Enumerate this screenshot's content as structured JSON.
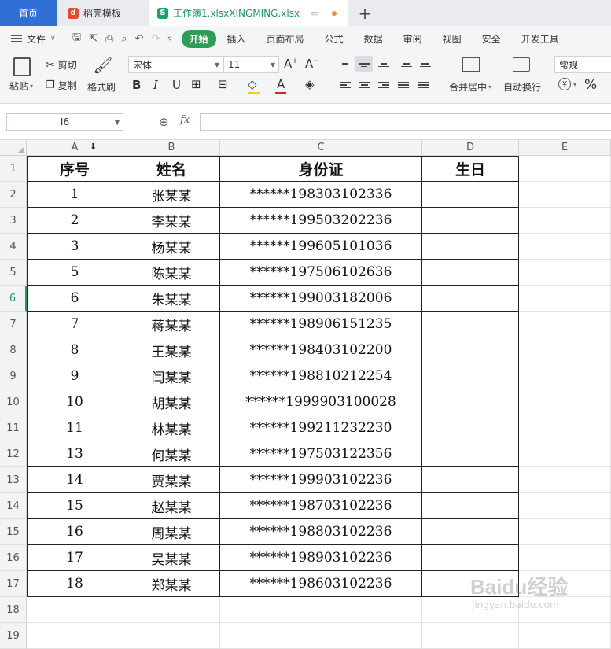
{
  "tabs": {
    "home": "首页",
    "template": "稻壳模板",
    "file": "工作簿1.xlsxXINGMING.xlsx",
    "plus": "+"
  },
  "menubar": {
    "file": "文件",
    "active": "开始",
    "items": [
      "插入",
      "页面布局",
      "公式",
      "数据",
      "审阅",
      "视图",
      "安全",
      "开发工具"
    ]
  },
  "ribbon": {
    "paste": "粘贴",
    "cut": "剪切",
    "copy": "复制",
    "format_painter": "格式刷",
    "font_name": "宋体",
    "font_size": "11",
    "merge_center": "合并居中",
    "wrap_text": "自动换行",
    "number_format": "常规",
    "currency": "¥",
    "percent": "%"
  },
  "formula_bar": {
    "name_box": "I6",
    "fx": "fx",
    "value": ""
  },
  "columns": [
    "A",
    "B",
    "C",
    "D",
    "E"
  ],
  "rows": [
    "1",
    "2",
    "3",
    "4",
    "5",
    "6",
    "7",
    "8",
    "9",
    "10",
    "11",
    "12",
    "13",
    "14",
    "15",
    "16",
    "17",
    "18",
    "19"
  ],
  "active_row": "6",
  "table": {
    "headers": [
      "序号",
      "姓名",
      "身份证",
      "生日"
    ],
    "records": [
      [
        "1",
        "张某某",
        "******198303102336",
        ""
      ],
      [
        "2",
        "李某某",
        "******199503202236",
        ""
      ],
      [
        "3",
        "杨某某",
        "******199605101036",
        ""
      ],
      [
        "5",
        "陈某某",
        "******197506102636",
        ""
      ],
      [
        "6",
        "朱某某",
        "******199003182006",
        ""
      ],
      [
        "7",
        "蒋某某",
        "******198906151235",
        ""
      ],
      [
        "8",
        "王某某",
        "******198403102200",
        ""
      ],
      [
        "9",
        "闫某某",
        "******198810212254",
        ""
      ],
      [
        "10",
        "胡某某",
        "******1999903100028",
        ""
      ],
      [
        "11",
        "林某某",
        "******199211232230",
        ""
      ],
      [
        "13",
        "何某某",
        "******197503122356",
        ""
      ],
      [
        "14",
        "贾某某",
        "******199903102236",
        ""
      ],
      [
        "15",
        "赵某某",
        "******198703102236",
        ""
      ],
      [
        "16",
        "周某某",
        "******198803102236",
        ""
      ],
      [
        "17",
        "吴某某",
        "******198903102236",
        ""
      ],
      [
        "18",
        "郑某某",
        "******198603102236",
        ""
      ]
    ]
  },
  "watermark": {
    "brand": "Baidu经验",
    "url": "jingyan.baidu.com"
  },
  "colors": {
    "accent_green": "#2f9e54",
    "home_tab_blue": "#2f6fd6"
  }
}
